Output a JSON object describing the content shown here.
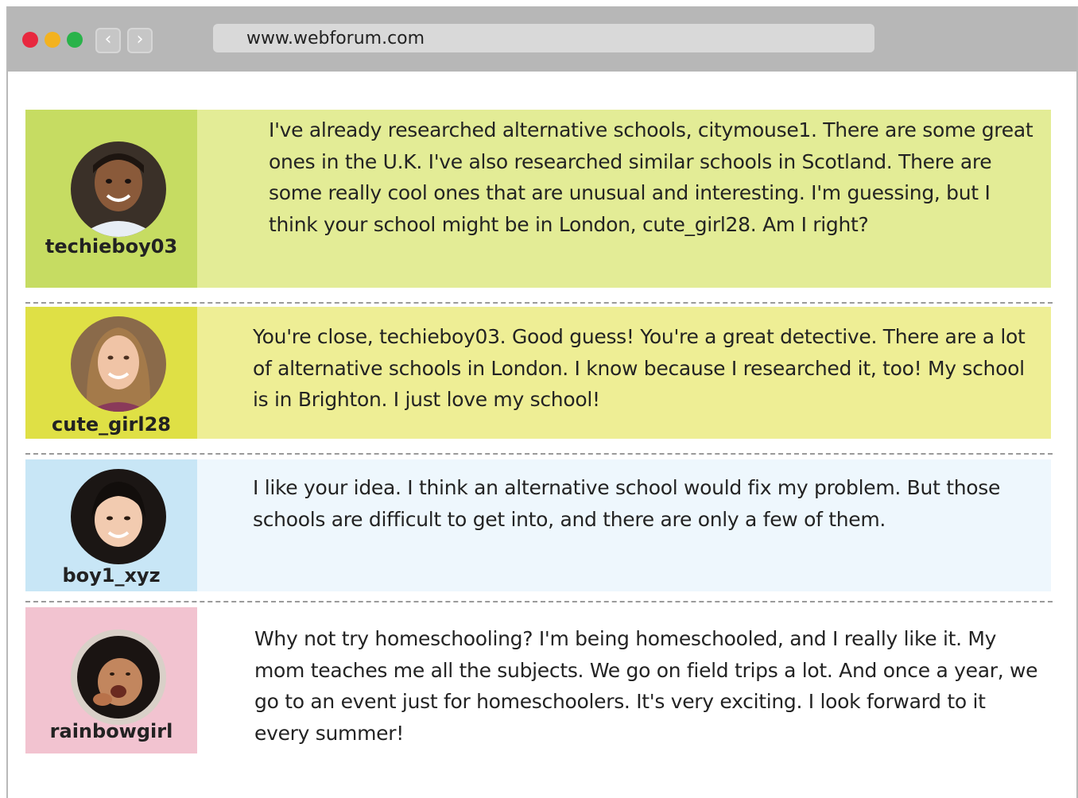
{
  "browser": {
    "url": "www.webforum.com",
    "back_icon": "chevron-left-icon",
    "forward_icon": "chevron-right-icon",
    "traffic_lights": [
      "#e8283f",
      "#f3b21f",
      "#29b34a"
    ]
  },
  "posts": [
    {
      "username": "techieboy03",
      "message": "I've already researched alternative schools, citymouse1. There are some great ones in the U.K. I've also researched similar schools in Scotland. There are some really cool ones that are unusual and interesting. I'm guessing, but I think your school might be in London, cute_girl28. Am I right?",
      "profile_color": "#c6dc62",
      "message_color": "#e3ec96"
    },
    {
      "username": "cute_girl28",
      "message": "You're close, techieboy03. Good guess! You're a great detective. There are a lot of alternative schools in London. I know because I researched it, too! My school is in Brighton. I just love my school!",
      "profile_color": "#dfe045",
      "message_color": "#eeee95"
    },
    {
      "username": "boy1_xyz",
      "message": "I like your idea. I think an alternative school would fix my problem. But those schools are difficult to get into, and there are only a few of them.",
      "profile_color": "#c8e6f6",
      "message_color": "#eef7fd"
    },
    {
      "username": "rainbowgirl",
      "message": "Why not try homeschooling? I'm being homeschooled, and I really like it. My mom teaches me all the subjects. We go on field trips a lot. And once a year, we go to an event just for homeschoolers. It's very exciting. I look forward to it every summer!",
      "profile_color": "#f2c3d0",
      "message_color": "#ffffff"
    }
  ]
}
